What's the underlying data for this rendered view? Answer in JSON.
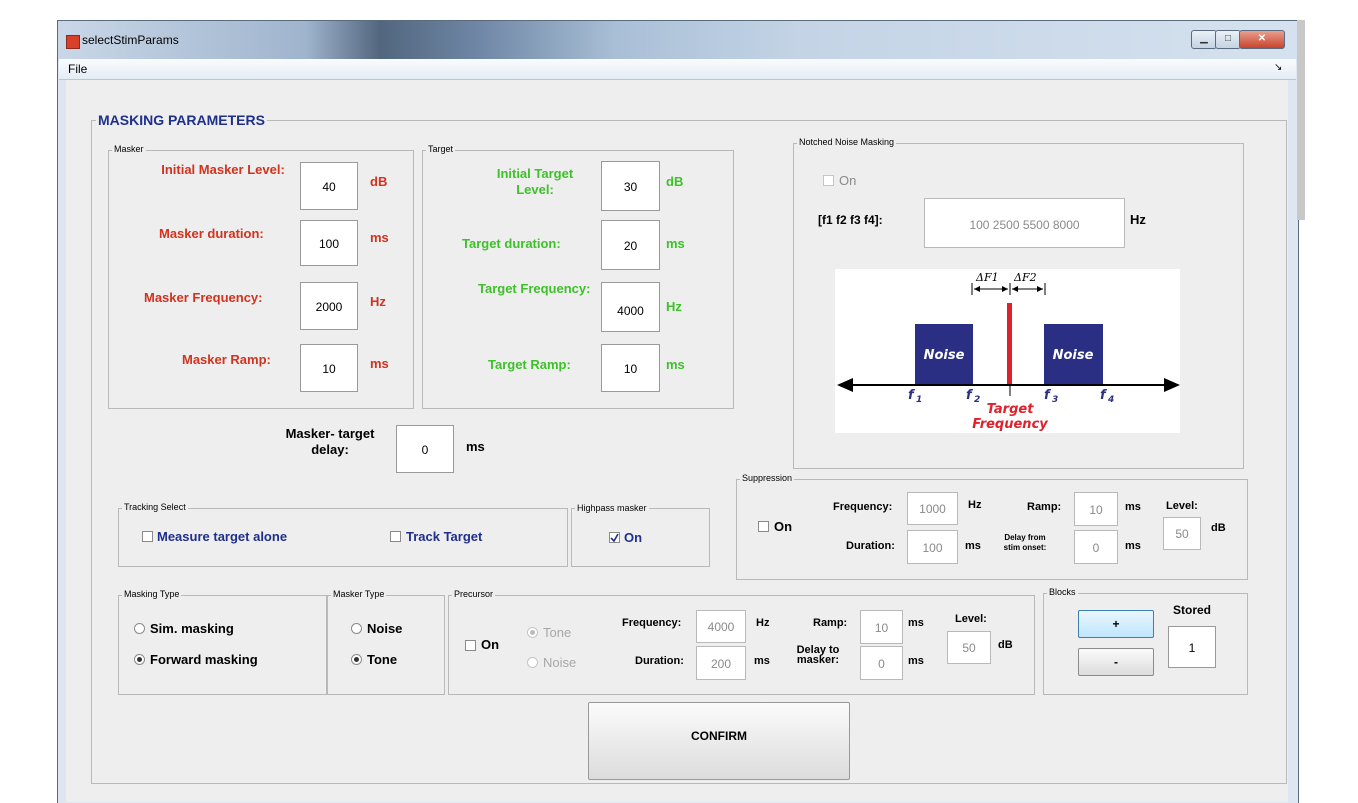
{
  "window": {
    "title": "selectStimParams",
    "minimize": "▁",
    "maximize": "□",
    "close": "✕"
  },
  "menu": {
    "file": "File",
    "dock_arrow": "↘"
  },
  "main_title": "MASKING PARAMETERS",
  "masker": {
    "panel": "Masker",
    "initial_level_label": "Initial Masker Level:",
    "initial_level": "40",
    "initial_level_unit": "dB",
    "duration_label": "Masker duration:",
    "duration": "100",
    "duration_unit": "ms",
    "frequency_label": "Masker Frequency:",
    "frequency": "2000",
    "frequency_unit": "Hz",
    "ramp_label": "Masker Ramp:",
    "ramp": "10",
    "ramp_unit": "ms"
  },
  "target": {
    "panel": "Target",
    "initial_level_label": "Initial Target Level:",
    "initial_level": "30",
    "initial_level_unit": "dB",
    "duration_label": "Target duration:",
    "duration": "20",
    "duration_unit": "ms",
    "frequency_label": "Target Frequency:",
    "frequency": "4000",
    "frequency_unit": "Hz",
    "ramp_label": "Target Ramp:",
    "ramp": "10",
    "ramp_unit": "ms"
  },
  "delay": {
    "label": "Masker- target delay:",
    "value": "0",
    "unit": "ms"
  },
  "notched": {
    "panel": "Notched Noise Masking",
    "on_label": "On",
    "f_label": "[f1 f2 f3 f4]:",
    "f_value": "100 2500 5500 8000",
    "f_unit": "Hz",
    "diagram": {
      "noise_label": "Noise",
      "df1": "ΔF1",
      "df2": "ΔF2",
      "f1": "f",
      "f2": "f",
      "f3": "f",
      "f4": "f",
      "s1": "1",
      "s2": "2",
      "s3": "3",
      "s4": "4",
      "target_line1": "Target",
      "target_line2": "Frequency",
      "colors": {
        "noise": "#2b2f84",
        "target": "#e0202a"
      }
    }
  },
  "suppression": {
    "panel": "Suppression",
    "on_label": "On",
    "frequency_label": "Frequency:",
    "frequency": "1000",
    "frequency_unit": "Hz",
    "duration_label": "Duration:",
    "duration": "100",
    "duration_unit": "ms",
    "ramp_label": "Ramp:",
    "ramp": "10",
    "ramp_unit": "ms",
    "delay_label": "Delay from stim onset:",
    "delay": "0",
    "delay_unit": "ms",
    "level_label": "Level:",
    "level": "50",
    "level_unit": "dB"
  },
  "tracking": {
    "panel": "Tracking Select",
    "measure_alone": "Measure target alone",
    "track_target": "Track Target"
  },
  "highpass": {
    "panel": "Highpass masker",
    "on_label": "On"
  },
  "masking_type": {
    "panel": "Masking Type",
    "sim": "Sim. masking",
    "forward": "Forward masking",
    "selected": "Forward masking"
  },
  "masker_type": {
    "panel": "Masker Type",
    "noise": "Noise",
    "tone": "Tone",
    "selected": "Tone"
  },
  "precursor": {
    "panel": "Precursor",
    "on_label": "On",
    "tone": "Tone",
    "noise": "Noise",
    "frequency_label": "Frequency:",
    "frequency": "4000",
    "frequency_unit": "Hz",
    "duration_label": "Duration:",
    "duration": "200",
    "duration_unit": "ms",
    "ramp_label": "Ramp:",
    "ramp": "10",
    "ramp_unit": "ms",
    "delay_label": "Delay to masker:",
    "delay": "0",
    "delay_unit": "ms",
    "level_label": "Level:",
    "level": "50",
    "level_unit": "dB"
  },
  "blocks": {
    "panel": "Blocks",
    "plus": "+",
    "minus": "-",
    "stored_label": "Stored",
    "stored": "1"
  },
  "confirm": "CONFIRM"
}
